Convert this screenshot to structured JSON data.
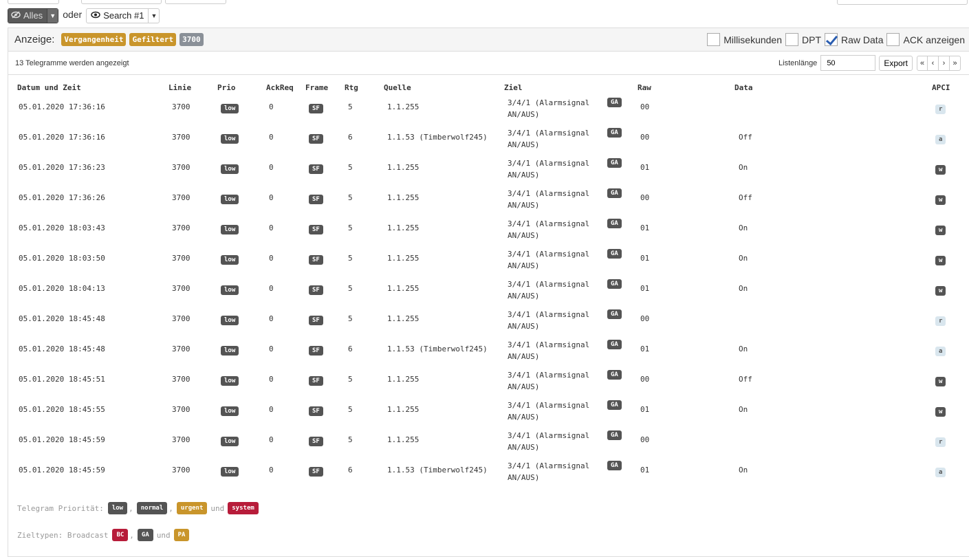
{
  "toolbar": {
    "all_label": "Alles",
    "or_label": "oder",
    "search_label": "Search #1"
  },
  "display": {
    "label": "Anzeige:",
    "tags": [
      "Vergangenheit",
      "Gefiltert",
      "3700"
    ],
    "options": [
      {
        "label": "Millisekunden",
        "checked": false
      },
      {
        "label": "DPT",
        "checked": false
      },
      {
        "label": "Raw Data",
        "checked": true
      },
      {
        "label": "ACK anzeigen",
        "checked": false
      }
    ]
  },
  "status": {
    "count_text": "13 Telegramme werden angezeigt",
    "list_length_label": "Listenlänge",
    "list_length_value": "50",
    "export_label": "Export",
    "pager": [
      "«",
      "‹",
      "›",
      "»"
    ]
  },
  "table": {
    "headers": {
      "datetime": "Datum und Zeit",
      "line": "Linie",
      "prio": "Prio",
      "ackreq": "AckReq",
      "frame": "Frame",
      "rtg": "Rtg",
      "source": "Quelle",
      "target": "Ziel",
      "raw": "Raw",
      "data": "Data",
      "apci": "APCI"
    },
    "rows": [
      {
        "datetime": "05.01.2020 17:36:16",
        "line": "3700",
        "prio": "low",
        "ackreq": "0",
        "frame": "SF",
        "rtg": "5",
        "source": "1.1.255",
        "target1": "3/4/1 (Alarmsignal",
        "target2": "AN/AUS)",
        "type": "GA",
        "raw": "00",
        "data": "",
        "apci": "r"
      },
      {
        "datetime": "05.01.2020 17:36:16",
        "line": "3700",
        "prio": "low",
        "ackreq": "0",
        "frame": "SF",
        "rtg": "6",
        "source": "1.1.53 (Timberwolf245)",
        "target1": "3/4/1 (Alarmsignal",
        "target2": "AN/AUS)",
        "type": "GA",
        "raw": "00",
        "data": "Off",
        "apci": "a"
      },
      {
        "datetime": "05.01.2020 17:36:23",
        "line": "3700",
        "prio": "low",
        "ackreq": "0",
        "frame": "SF",
        "rtg": "5",
        "source": "1.1.255",
        "target1": "3/4/1 (Alarmsignal",
        "target2": "AN/AUS)",
        "type": "GA",
        "raw": "01",
        "data": "On",
        "apci": "w"
      },
      {
        "datetime": "05.01.2020 17:36:26",
        "line": "3700",
        "prio": "low",
        "ackreq": "0",
        "frame": "SF",
        "rtg": "5",
        "source": "1.1.255",
        "target1": "3/4/1 (Alarmsignal",
        "target2": "AN/AUS)",
        "type": "GA",
        "raw": "00",
        "data": "Off",
        "apci": "w"
      },
      {
        "datetime": "05.01.2020 18:03:43",
        "line": "3700",
        "prio": "low",
        "ackreq": "0",
        "frame": "SF",
        "rtg": "5",
        "source": "1.1.255",
        "target1": "3/4/1 (Alarmsignal",
        "target2": "AN/AUS)",
        "type": "GA",
        "raw": "01",
        "data": "On",
        "apci": "w"
      },
      {
        "datetime": "05.01.2020 18:03:50",
        "line": "3700",
        "prio": "low",
        "ackreq": "0",
        "frame": "SF",
        "rtg": "5",
        "source": "1.1.255",
        "target1": "3/4/1 (Alarmsignal",
        "target2": "AN/AUS)",
        "type": "GA",
        "raw": "01",
        "data": "On",
        "apci": "w"
      },
      {
        "datetime": "05.01.2020 18:04:13",
        "line": "3700",
        "prio": "low",
        "ackreq": "0",
        "frame": "SF",
        "rtg": "5",
        "source": "1.1.255",
        "target1": "3/4/1 (Alarmsignal",
        "target2": "AN/AUS)",
        "type": "GA",
        "raw": "01",
        "data": "On",
        "apci": "w"
      },
      {
        "datetime": "05.01.2020 18:45:48",
        "line": "3700",
        "prio": "low",
        "ackreq": "0",
        "frame": "SF",
        "rtg": "5",
        "source": "1.1.255",
        "target1": "3/4/1 (Alarmsignal",
        "target2": "AN/AUS)",
        "type": "GA",
        "raw": "00",
        "data": "",
        "apci": "r"
      },
      {
        "datetime": "05.01.2020 18:45:48",
        "line": "3700",
        "prio": "low",
        "ackreq": "0",
        "frame": "SF",
        "rtg": "6",
        "source": "1.1.53 (Timberwolf245)",
        "target1": "3/4/1 (Alarmsignal",
        "target2": "AN/AUS)",
        "type": "GA",
        "raw": "01",
        "data": "On",
        "apci": "a"
      },
      {
        "datetime": "05.01.2020 18:45:51",
        "line": "3700",
        "prio": "low",
        "ackreq": "0",
        "frame": "SF",
        "rtg": "5",
        "source": "1.1.255",
        "target1": "3/4/1 (Alarmsignal",
        "target2": "AN/AUS)",
        "type": "GA",
        "raw": "00",
        "data": "Off",
        "apci": "w"
      },
      {
        "datetime": "05.01.2020 18:45:55",
        "line": "3700",
        "prio": "low",
        "ackreq": "0",
        "frame": "SF",
        "rtg": "5",
        "source": "1.1.255",
        "target1": "3/4/1 (Alarmsignal",
        "target2": "AN/AUS)",
        "type": "GA",
        "raw": "01",
        "data": "On",
        "apci": "w"
      },
      {
        "datetime": "05.01.2020 18:45:59",
        "line": "3700",
        "prio": "low",
        "ackreq": "0",
        "frame": "SF",
        "rtg": "5",
        "source": "1.1.255",
        "target1": "3/4/1 (Alarmsignal",
        "target2": "AN/AUS)",
        "type": "GA",
        "raw": "00",
        "data": "",
        "apci": "r"
      },
      {
        "datetime": "05.01.2020 18:45:59",
        "line": "3700",
        "prio": "low",
        "ackreq": "0",
        "frame": "SF",
        "rtg": "6",
        "source": "1.1.53 (Timberwolf245)",
        "target1": "3/4/1 (Alarmsignal",
        "target2": "AN/AUS)",
        "type": "GA",
        "raw": "01",
        "data": "On",
        "apci": "a"
      }
    ]
  },
  "legend": {
    "priority_label": "Telegram Priorität:",
    "priorities": [
      "low",
      "normal",
      "urgent",
      "system"
    ],
    "sep": ",",
    "and": "und",
    "types_label": "Zieltypen: Broadcast",
    "types": [
      "BC",
      "GA",
      "PA"
    ]
  },
  "colors": {
    "warning": "#c9952b",
    "danger": "#b71c3a",
    "dark": "#545454",
    "light": "#d9e6ee"
  }
}
